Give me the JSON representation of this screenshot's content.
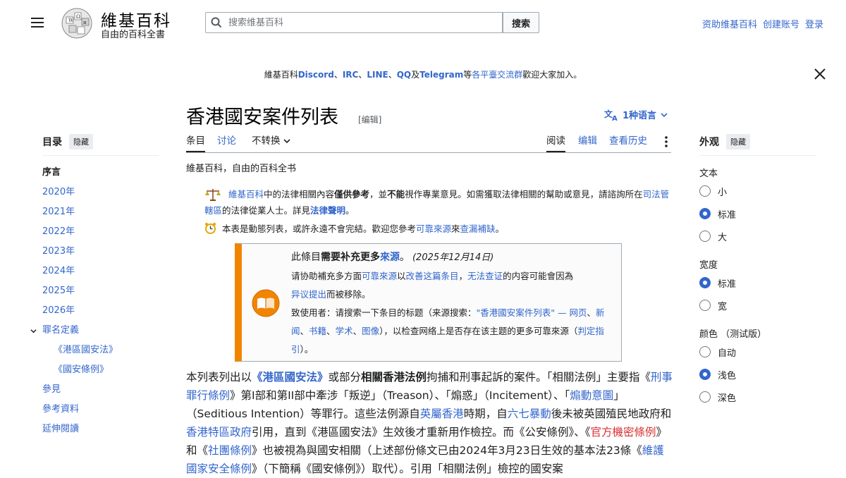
{
  "header": {
    "logo_title": "維基百科",
    "logo_tagline": "自由的百科全書",
    "search_placeholder": "搜索维基百科",
    "search_button": "搜索",
    "user_links": [
      "资助维基百科",
      "创建账号",
      "登录"
    ]
  },
  "banner": {
    "p1": "維基百科",
    "discord": "Discord",
    "sep1": "、",
    "irc": "IRC",
    "sep2": "、",
    "line": "LINE",
    "sep3": "、",
    "qq": "QQ",
    "and": "及",
    "telegram": "Telegram",
    "p2": "等",
    "groups_link": "各平臺交流群",
    "p3": "歡迎大家加入。"
  },
  "toc": {
    "title": "目录",
    "hide": "隐藏",
    "items": [
      {
        "label": "序言"
      },
      {
        "label": "2020年"
      },
      {
        "label": "2021年"
      },
      {
        "label": "2022年"
      },
      {
        "label": "2023年"
      },
      {
        "label": "2024年"
      },
      {
        "label": "2025年"
      },
      {
        "label": "2026年"
      },
      {
        "label": "罪名定義"
      },
      {
        "label": "《港區國安法》"
      },
      {
        "label": "《國安條例》"
      },
      {
        "label": "參見"
      },
      {
        "label": "參考資料"
      },
      {
        "label": "延伸閱讀"
      }
    ]
  },
  "page": {
    "title": "香港國安案件列表",
    "edit": "[编辑]",
    "lang": "1种语言",
    "tabs": {
      "article": "条目",
      "talk": "讨论",
      "variant": "不转换",
      "read": "阅读",
      "edit": "编辑",
      "history": "查看历史"
    },
    "from": "維基百科，自由的百科全书"
  },
  "notice": {
    "wp_link": "維基百科",
    "t1": "中的法律相關內容",
    "bold1": "僅供參考",
    "t2": "，並",
    "bold2": "不能",
    "t3": "視作專業意見。如需獲取法律相關的幫助或意見，請諮詢所在",
    "juris_link": "司法管轄區",
    "t4": "的法律從業人士。詳見",
    "disclaimer_link": "法律聲明",
    "t5": "。"
  },
  "dynamic": {
    "t1": "本表是動態列表，或許永遠不會完結。歡迎您參考",
    "reliable_link": "可靠來源",
    "t2": "來",
    "fill_link": "查漏補缺",
    "t3": "。"
  },
  "ambox": {
    "l1a": "此條目",
    "l1b": "需要补充更多",
    "l1c": "來源",
    "l1d": "。",
    "date": "(2025年12月14日)",
    "l2a": "请协助補充多方面",
    "l2b": "可靠來源",
    "l2c": "以",
    "l2d": "改善这篇条目",
    "l2e": "，",
    "l2f": "无法查证",
    "l2g": "的内容可能會因為",
    "l3a": "异议提出",
    "l3b": "而被移除。",
    "l4a": "致使用者：请搜索一下条目的标题（来源搜索：",
    "l4b": "\"香港國安案件列表\" — 网页",
    "l4c": "、",
    "l4d": "新闻",
    "l4e": "、",
    "l4f": "书籍",
    "l4g": "、",
    "l4h": "学术",
    "l4i": "、",
    "l4j": "图像",
    "l4k": "），以检查网络上是否存在该主题的更多可靠來源（",
    "l4l": "判定指引",
    "l4m": "）。"
  },
  "article": {
    "a1": "本列表列出以",
    "a2": "《港區國安法》",
    "a3": "或部分",
    "a4": "相關香港法例",
    "a5": "拘捕和刑事起訴的案件。「相關法例」主要指《",
    "a6": "刑事罪行條例",
    "a7": "》第I部和第II部中牽涉「叛逆」（Treason）、「煽惑」（Incitement）、「",
    "a8": "煽動意圖",
    "a9": "」（Seditious Intention）等罪行。這些法例源自",
    "a10": "英屬香港",
    "a11": "時期，自",
    "a12": "六七暴動",
    "a13": "後未被英國殖民地政府和",
    "a14": "香港特區政府",
    "a15": "引用，直到《港區國安法》生效後才重新用作檢控。而《公安條例》、《",
    "a16": "官方機密條例",
    "a17": "》和《",
    "a18": "社團條例",
    "a19": "》也被視為與國安相關（上述部份條文已由2024年3月23日生效的基本法23條《",
    "a20": "維護國家安全條例",
    "a21": "》（下簡稱《國安條例》）取代）。引用「相關法例」檢控的國安案"
  },
  "appearance": {
    "title": "外观",
    "hide": "隐藏",
    "text_label": "文本",
    "text_options": [
      "小",
      "标准",
      "大"
    ],
    "width_label": "宽度",
    "width_options": [
      "标准",
      "宽"
    ],
    "color_label": "颜色 （测试版）",
    "color_options": [
      "自动",
      "浅色",
      "深色"
    ]
  },
  "colors": {
    "link": "#3366cc",
    "redlink": "#d73333",
    "ambox_accent": "#f28500"
  }
}
